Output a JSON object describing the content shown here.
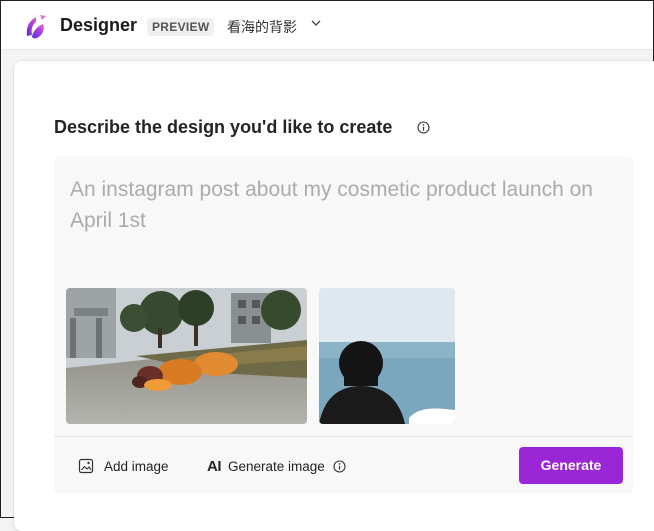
{
  "header": {
    "app_title": "Designer",
    "badge": "PREVIEW",
    "account_name": "看海的背影"
  },
  "main": {
    "heading": "Describe the design you'd like to create",
    "prompt_placeholder": "An instagram post about my cosmetic product launch on April 1st",
    "toolbar": {
      "add_image_label": "Add image",
      "generate_image_label": "Generate image",
      "generate_button_label": "Generate"
    }
  },
  "colors": {
    "accent": "#9b26d6",
    "placeholder_text": "#ababab",
    "prompt_background": "#f8f8f8"
  },
  "icons": [
    "designer-logo-icon",
    "chevron-down-icon",
    "info-icon",
    "image-icon"
  ]
}
